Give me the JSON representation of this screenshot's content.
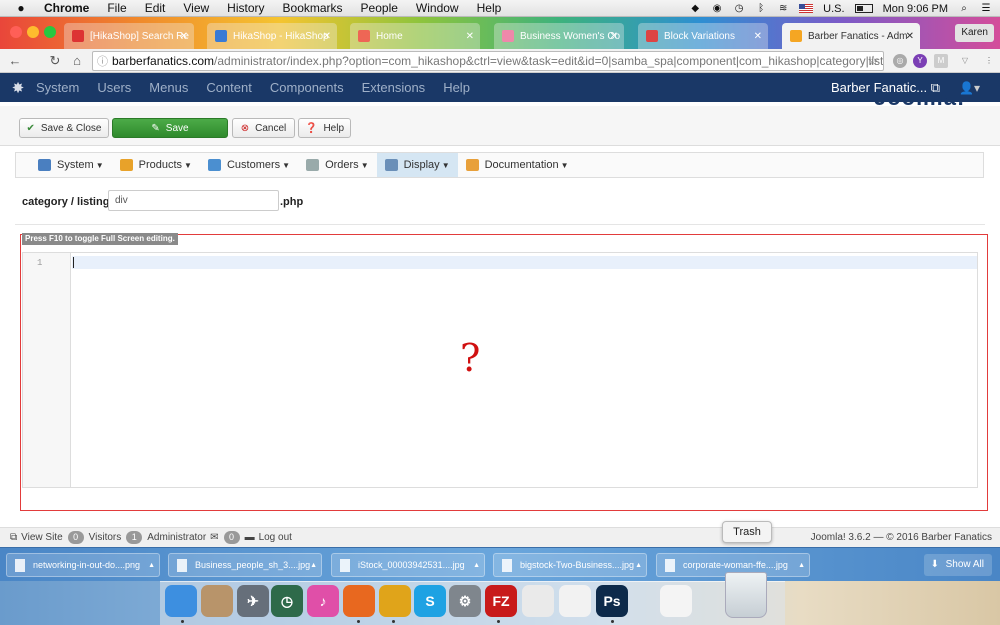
{
  "macmenu": {
    "app": "Chrome",
    "items": [
      "File",
      "Edit",
      "View",
      "History",
      "Bookmarks",
      "People",
      "Window",
      "Help"
    ],
    "input_source": "U.S.",
    "clock": "Mon 9:06 PM"
  },
  "tabs": [
    {
      "label": "[HikaShop] Search Re",
      "fav_color": "#d33"
    },
    {
      "label": "HikaShop - HikaShop",
      "fav_color": "#3a7bd5"
    },
    {
      "label": "Home",
      "fav_color": "#e65"
    },
    {
      "label": "Business Women's Co",
      "fav_color": "#e8a"
    },
    {
      "label": "Block Variations",
      "fav_color": "#d44"
    },
    {
      "label": "Barber Fanatics - Adm",
      "fav_color": "#f5a623"
    }
  ],
  "profile": "Karen",
  "address": {
    "domain": "barberfanatics.com",
    "path": "/administrator/index.php?option=com_hikashop&ctrl=view&task=edit&id=0|samba_spa|component|com_hikashop|category|listi..."
  },
  "joomla_nav": {
    "items": [
      "System",
      "Users",
      "Menus",
      "Content",
      "Components",
      "Extensions",
      "Help"
    ],
    "site_link": "Barber Fanatic...",
    "brand": "Joomla!"
  },
  "toolbar": {
    "save_close": "Save & Close",
    "save": "Save",
    "cancel": "Cancel",
    "help": "Help"
  },
  "submenu": [
    {
      "label": "System",
      "color": "#4a7fc0"
    },
    {
      "label": "Products",
      "color": "#e8a22a"
    },
    {
      "label": "Customers",
      "color": "#4b8fd0"
    },
    {
      "label": "Orders",
      "color": "#9aa"
    },
    {
      "label": "Display",
      "color": "#6a8fb8"
    },
    {
      "label": "Documentation",
      "color": "#e8a03a"
    }
  ],
  "file": {
    "prefix": "category / listing_",
    "input_value": "div",
    "suffix": ".php"
  },
  "editor": {
    "hint": "Press F10 to toggle Full Screen editing.",
    "line_number": "1",
    "overlay_mark": "?"
  },
  "status": {
    "view_site": "View Site",
    "visitors_count": "0",
    "visitors": "Visitors",
    "admin_count": "1",
    "admin": "Administrator",
    "messages_count": "0",
    "logout": "Log out",
    "footer": "Joomla! 3.6.2  —  © 2016 Barber Fanatics"
  },
  "downloads": [
    "networking-in-out-do....png",
    "Business_people_sh_3....jpg",
    "iStock_00003942531....jpg",
    "bigstock-Two-Business....jpg",
    "corporate-woman-ffe....jpg"
  ],
  "show_all": "Show All",
  "dock": {
    "trash_tooltip": "Trash",
    "apps": [
      {
        "name": "finder-icon",
        "color": "#3d8fe0",
        "glyph": ""
      },
      {
        "name": "contacts-icon",
        "color": "#b8946a",
        "glyph": ""
      },
      {
        "name": "launchpad-icon",
        "color": "#666f7a",
        "glyph": "✈"
      },
      {
        "name": "time-machine-icon",
        "color": "#2e6a4a",
        "glyph": "◷"
      },
      {
        "name": "itunes-icon",
        "color": "#e04fa8",
        "glyph": "♪"
      },
      {
        "name": "firefox-icon",
        "color": "#e8681f",
        "glyph": ""
      },
      {
        "name": "chrome-icon",
        "color": "#e0a41a",
        "glyph": ""
      },
      {
        "name": "skype-icon",
        "color": "#1ea2e3",
        "glyph": "S"
      },
      {
        "name": "system-preferences-icon",
        "color": "#7f868d",
        "glyph": "⚙"
      },
      {
        "name": "filezilla-icon",
        "color": "#c81a1a",
        "glyph": "FZ"
      },
      {
        "name": "textedit-icon",
        "color": "#eaeaea",
        "glyph": ""
      },
      {
        "name": "photos-icon",
        "color": "#f2f2f2",
        "glyph": ""
      },
      {
        "name": "photoshop-icon",
        "color": "#0d2a4a",
        "glyph": "Ps"
      },
      {
        "name": "pdf-document-icon",
        "color": "#f4f4f4",
        "glyph": ""
      }
    ]
  }
}
